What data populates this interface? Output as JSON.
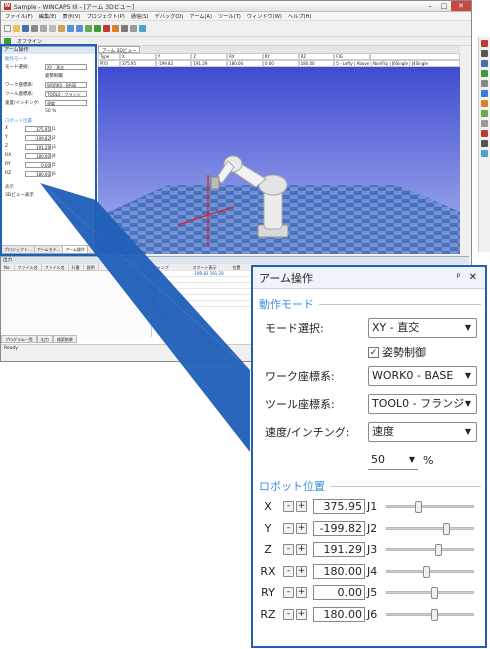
{
  "app": {
    "title": "Sample - WINCAPS III - [アーム 3Dビュー]",
    "menu": [
      "ファイル(F)",
      "編集(E)",
      "表示(V)",
      "プロジェクト(P)",
      "通信(S)",
      "デバッグ(D)",
      "アーム(A)",
      "ツール(T)",
      "ウィンドウ(W)",
      "ヘルプ(H)"
    ],
    "toolbar2_mode": "オフライン",
    "small_panel": {
      "title": "アーム操作",
      "section1": "動作モード",
      "mode_label": "モード選択:",
      "mode_value": "XY - 直交",
      "posture": "姿勢制御",
      "work_label": "ワーク座標系:",
      "work_value": "WORK0 - BASE",
      "tool_label": "ツール座標系:",
      "tool_value": "TOOL0 - フランジ",
      "speed_label": "速度/インチング:",
      "speed_value": "速度",
      "speed_num": "50",
      "speed_unit": "%",
      "section2": "ロボット位置",
      "section3": "表示",
      "view3d_check": "3Dビュー表示",
      "tabs": [
        "プロジェクト...",
        "アームモデ...",
        "アーム操作"
      ]
    },
    "view_tab": "アーム 3Dビュー",
    "grid_header": [
      "Type",
      "X",
      "Y",
      "Z",
      "RX",
      "RY",
      "RZ",
      "FIG"
    ],
    "grid_row": [
      "P[0]",
      "375.95",
      "-199.82",
      "191.29",
      "180.00",
      "0.00",
      "180.00",
      "5 - Lefty | Above | NonFlip | J6Single | J4Single"
    ],
    "bottom": {
      "head": "出力",
      "cols": [
        "No.",
        "ファイル名",
        "ファイル名",
        "行番",
        "説明"
      ],
      "tabs": [
        "プログラム一覧",
        "出力",
        "検索結果"
      ],
      "table_head": [
        "ジャンプ",
        "スマート表示",
        "位置"
      ],
      "table_rows": [
        [
          "P[0]",
          "-199.82 191.29"
        ],
        [
          "J1",
          ""
        ],
        [
          "J2",
          ""
        ],
        [
          "J3",
          ""
        ],
        [
          "J4",
          ""
        ],
        [
          "J5",
          ""
        ]
      ],
      "table_tabs": [
        "P",
        "J",
        "T"
      ]
    },
    "status": "Ready"
  },
  "panel": {
    "title": "アーム操作",
    "pin": "ᵖ",
    "close": "✕",
    "section_mode": "動作モード",
    "mode": {
      "label": "モード選択:",
      "value": "XY - 直交"
    },
    "posture": {
      "label": "姿勢制御",
      "checked": true
    },
    "work": {
      "label": "ワーク座標系:",
      "value": "WORK0 - BASE"
    },
    "tool": {
      "label": "ツール座標系:",
      "value": "TOOL0 - フランジ"
    },
    "speed": {
      "label": "速度/インチング:",
      "value": "速度"
    },
    "speed_percent": {
      "value": "50",
      "unit": "%"
    },
    "section_position": "ロボット位置",
    "minus": "-",
    "plus": "+",
    "positions": [
      {
        "axis": "X",
        "value": "375.95",
        "joint": "J1",
        "slider": 0.35
      },
      {
        "axis": "Y",
        "value": "-199.82",
        "joint": "J2",
        "slider": 0.7
      },
      {
        "axis": "Z",
        "value": "191.29",
        "joint": "J3",
        "slider": 0.6
      },
      {
        "axis": "RX",
        "value": "180.00",
        "joint": "J4",
        "slider": 0.45
      },
      {
        "axis": "RY",
        "value": "0.00",
        "joint": "J5",
        "slider": 0.55
      },
      {
        "axis": "RZ",
        "value": "180.00",
        "joint": "J6",
        "slider": 0.55
      }
    ]
  }
}
